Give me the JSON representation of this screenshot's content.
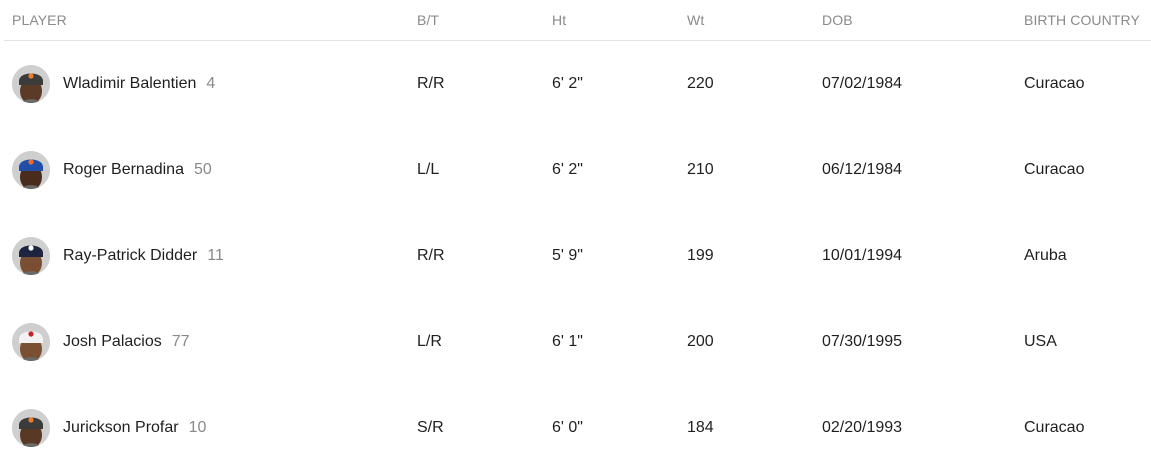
{
  "table": {
    "headers": {
      "player": "PLAYER",
      "bt": "B/T",
      "ht": "Ht",
      "wt": "Wt",
      "dob": "DOB",
      "country": "BIRTH COUNTRY"
    },
    "rows": [
      {
        "name": "Wladimir Balentien",
        "number": "4",
        "bt": "R/R",
        "ht": "6' 2\"",
        "wt": "220",
        "dob": "07/02/1984",
        "country": "Curacao",
        "cap_icon": "orange-cap-icon",
        "cap_color": "#3b3b3b",
        "logo_color": "#f07a2b",
        "skin_color": "#5b3a27"
      },
      {
        "name": "Roger Bernadina",
        "number": "50",
        "bt": "L/L",
        "ht": "6' 2\"",
        "wt": "210",
        "dob": "06/12/1984",
        "country": "Curacao",
        "cap_icon": "blue-cap-icon",
        "cap_color": "#1f4fa8",
        "logo_color": "#f06a2a",
        "skin_color": "#4a2c1c"
      },
      {
        "name": "Ray-Patrick Didder",
        "number": "11",
        "bt": "R/R",
        "ht": "5' 9\"",
        "wt": "199",
        "dob": "10/01/1994",
        "country": "Aruba",
        "cap_icon": "navy-cap-icon",
        "cap_color": "#1c2440",
        "logo_color": "#ffffff",
        "skin_color": "#7a4e33"
      },
      {
        "name": "Josh Palacios",
        "number": "77",
        "bt": "L/R",
        "ht": "6' 1\"",
        "wt": "200",
        "dob": "07/30/1995",
        "country": "USA",
        "cap_icon": "white-cap-icon",
        "cap_color": "#f2f2f2",
        "logo_color": "#c4232b",
        "skin_color": "#7b4f32"
      },
      {
        "name": "Jurickson Profar",
        "number": "10",
        "bt": "S/R",
        "ht": "6' 0\"",
        "wt": "184",
        "dob": "02/20/1993",
        "country": "Curacao",
        "cap_icon": "orange-cap-icon",
        "cap_color": "#3b3b3b",
        "logo_color": "#f07a2b",
        "skin_color": "#5a3826"
      }
    ]
  }
}
